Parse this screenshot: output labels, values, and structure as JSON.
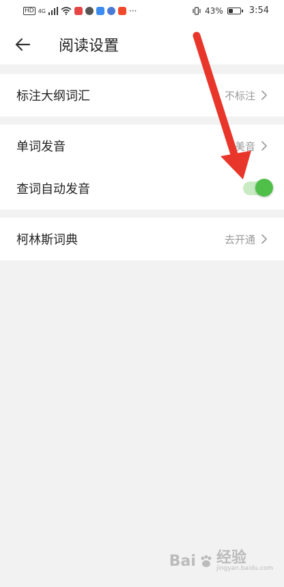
{
  "status_bar": {
    "network_label": "HD",
    "signal_label": "4G",
    "more": "···",
    "battery": "43%",
    "battery_level": 0.43,
    "time": "3:54"
  },
  "header": {
    "title": "阅读设置"
  },
  "settings": {
    "mark_vocab": {
      "label": "标注大纲词汇",
      "value": "不标注"
    },
    "pronunciation": {
      "label": "单词发音",
      "value": "美音"
    },
    "auto_pronounce": {
      "label": "查词自动发音",
      "enabled": true
    },
    "collins": {
      "label": "柯林斯词典",
      "value": "去开通"
    }
  },
  "colors": {
    "toggle_on": "#4fbf4a",
    "annotation_arrow": "#e8362b"
  },
  "watermark": {
    "brand": "Bai",
    "brand_suffix": "经验",
    "url": "jingyan.baidu.com"
  }
}
